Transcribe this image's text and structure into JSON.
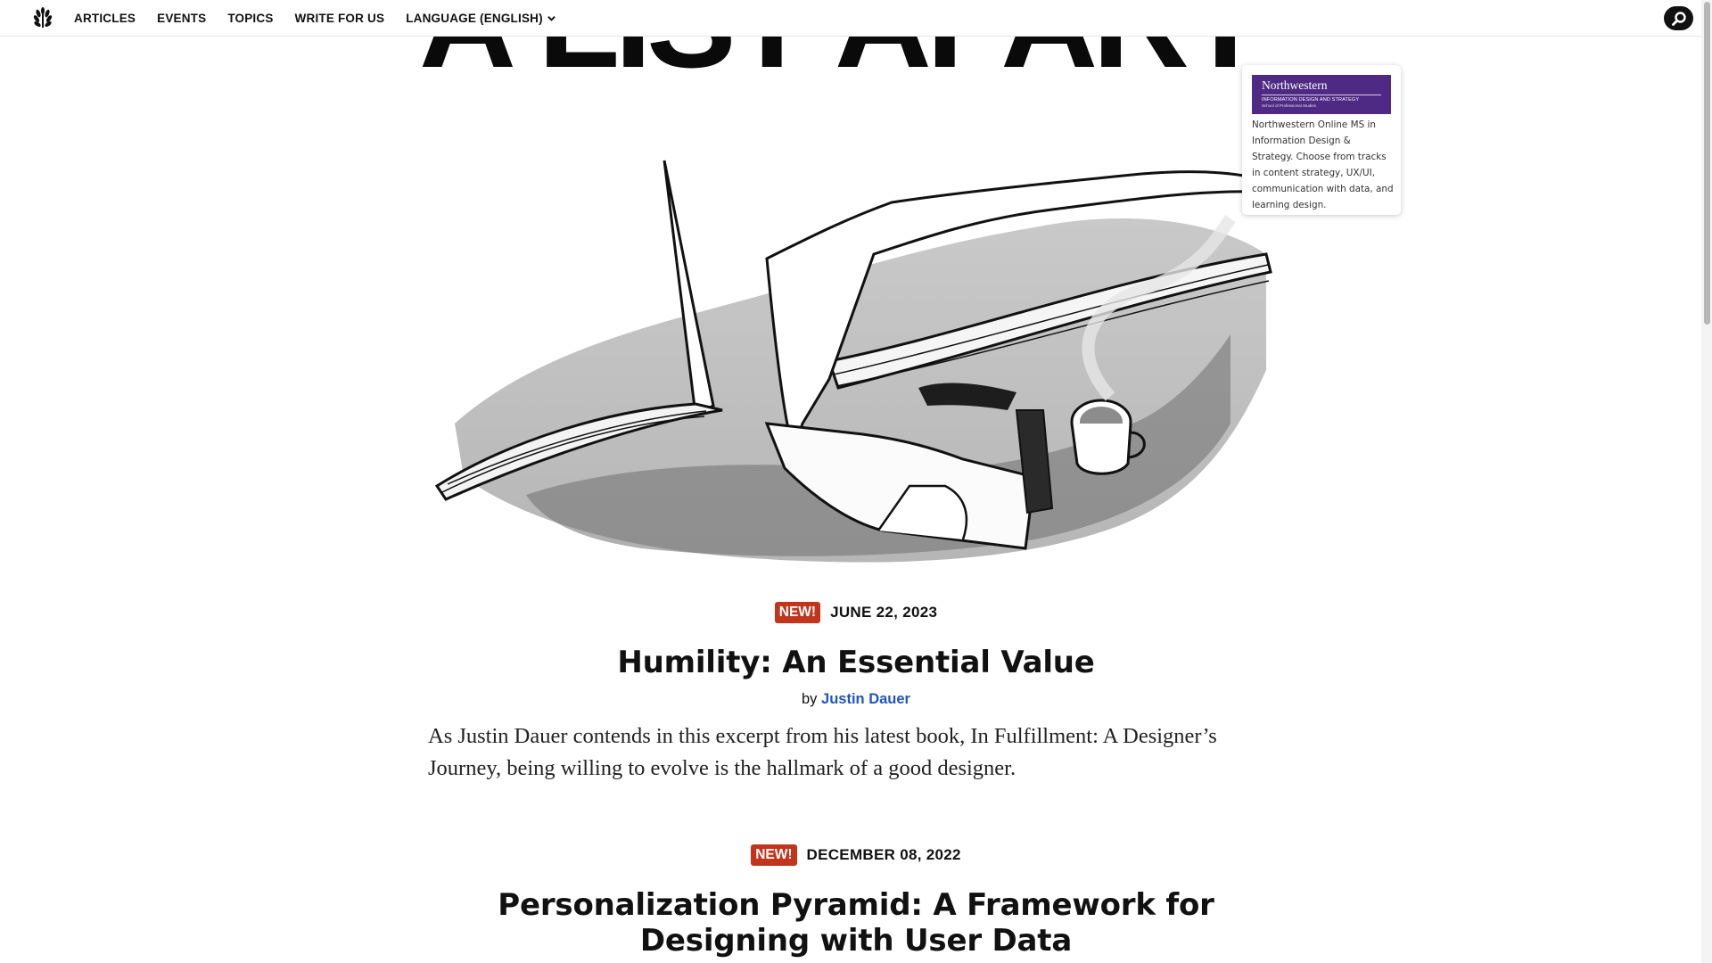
{
  "nav": {
    "items": [
      {
        "label": "ARTICLES"
      },
      {
        "label": "EVENTS"
      },
      {
        "label": "TOPICS"
      },
      {
        "label": "WRITE FOR US"
      },
      {
        "label": "LANGUAGE (ENGLISH)"
      }
    ],
    "search_icon": "search-icon",
    "logo_icon": "laurel-logo-icon"
  },
  "masthead": {
    "text": "A LIST APART"
  },
  "sponsor": {
    "logo_name": "Northwestern",
    "logo_sub": "INFORMATION DESIGN AND STRATEGY",
    "logo_sub2": "School of Professional Studies",
    "text": "Northwestern Online MS in Information Design & Strategy. Choose from tracks in content strategy, UX/UI, communication with data, and learning design."
  },
  "articles": [
    {
      "badge": "NEW!",
      "date": "JUNE 22, 2023",
      "title": "Humility: An Essential Value",
      "by": "by",
      "author": "Justin Dauer",
      "dek": "As Justin Dauer contends in this excerpt from his latest book, In Fulfillment: A Designer’s Journey, being willing to evolve is the hallmark of a good designer."
    },
    {
      "badge": "NEW!",
      "date": "DECEMBER 08, 2022",
      "title": "Personalization Pyramid: A Framework for Designing with User Data"
    }
  ],
  "colors": {
    "badge": "#c1351d",
    "author_link": "#1f55c4",
    "sponsor_brand": "#4e2a84"
  }
}
